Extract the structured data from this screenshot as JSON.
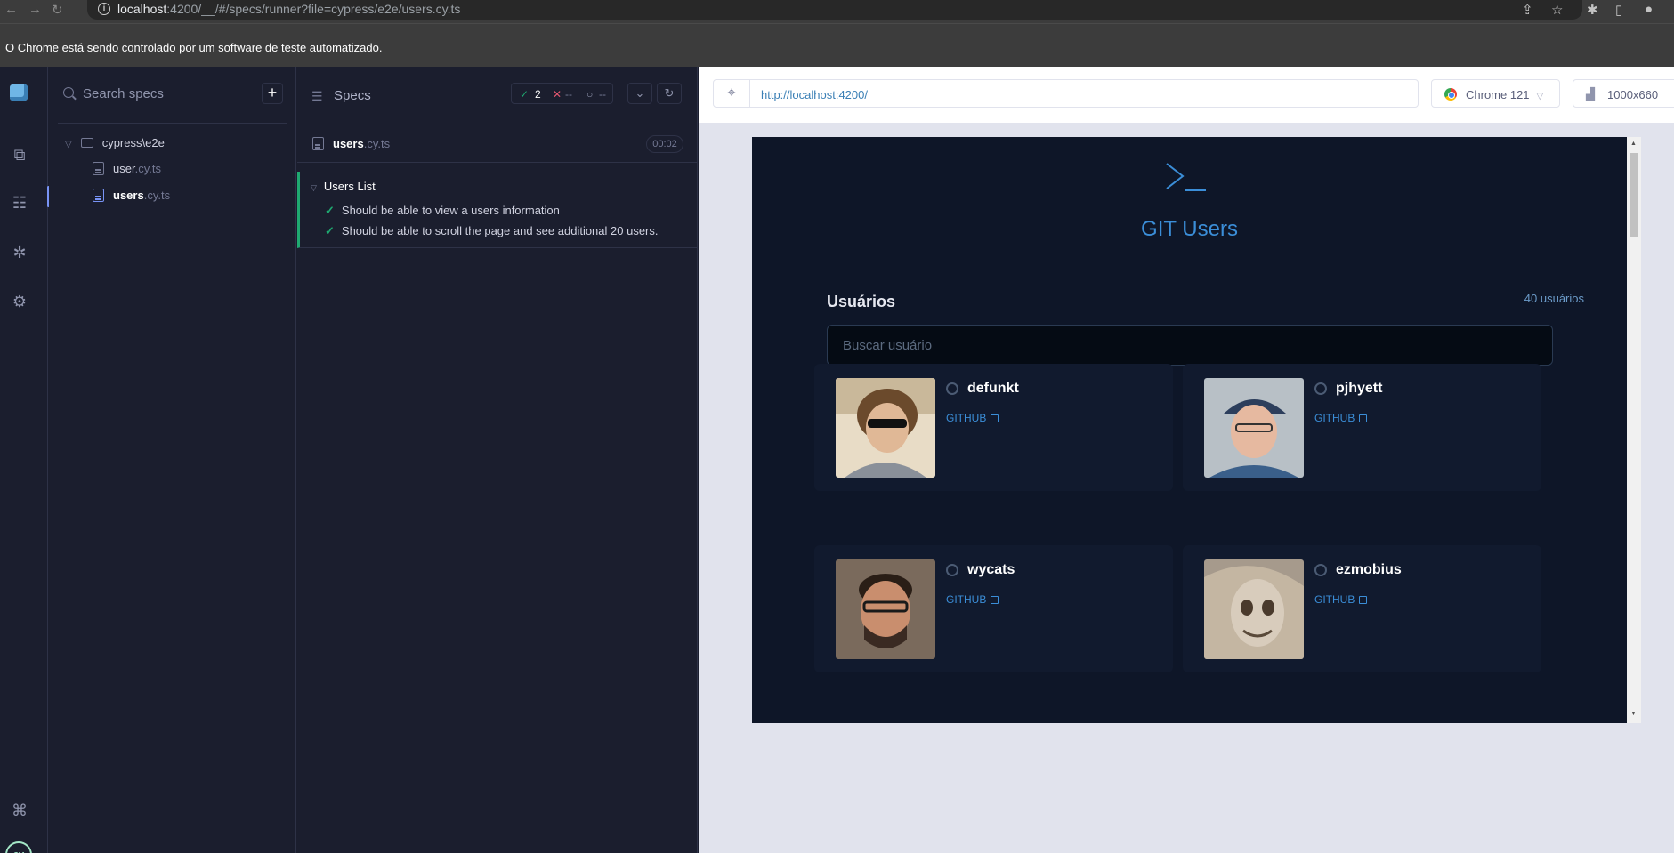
{
  "browser": {
    "url_host": "localhost",
    "url_rest": ":4200/__/#/specs/runner?file=cypress/e2e/users.cy.ts",
    "info_bar": "O Chrome está sendo controlado por um software de teste automatizado."
  },
  "specs_list": {
    "search_placeholder": "Search specs",
    "add_label": "+",
    "folder": "cypress\\e2e",
    "files": [
      {
        "base": "user",
        "ext": ".cy.ts"
      },
      {
        "base": "users",
        "ext": ".cy.ts"
      }
    ]
  },
  "reporter": {
    "title": "Specs",
    "passed": "2",
    "failed": "--",
    "pending": "--",
    "spec_base": "users",
    "spec_ext": ".cy.ts",
    "duration": "00:02",
    "suite": "Users List",
    "tests": [
      "Should be able to view a users information",
      "Should be able to scroll the page and see additional 20 users."
    ]
  },
  "aut": {
    "url": "http://localhost:4200/",
    "browser": "Chrome 121",
    "viewport": "1000x660"
  },
  "app": {
    "title": "GIT Users",
    "users_label": "Usuários",
    "users_count": "40 usuários",
    "search_placeholder": "Buscar usuário",
    "link_label": "GITHUB",
    "users": [
      {
        "name": "defunkt"
      },
      {
        "name": "pjhyett"
      },
      {
        "name": "wycats"
      },
      {
        "name": "ezmobius"
      }
    ]
  },
  "colors": {
    "pass": "#1fa971",
    "fail": "#e45770",
    "accent": "#3b8ed8",
    "app_bg": "#0e1628"
  }
}
